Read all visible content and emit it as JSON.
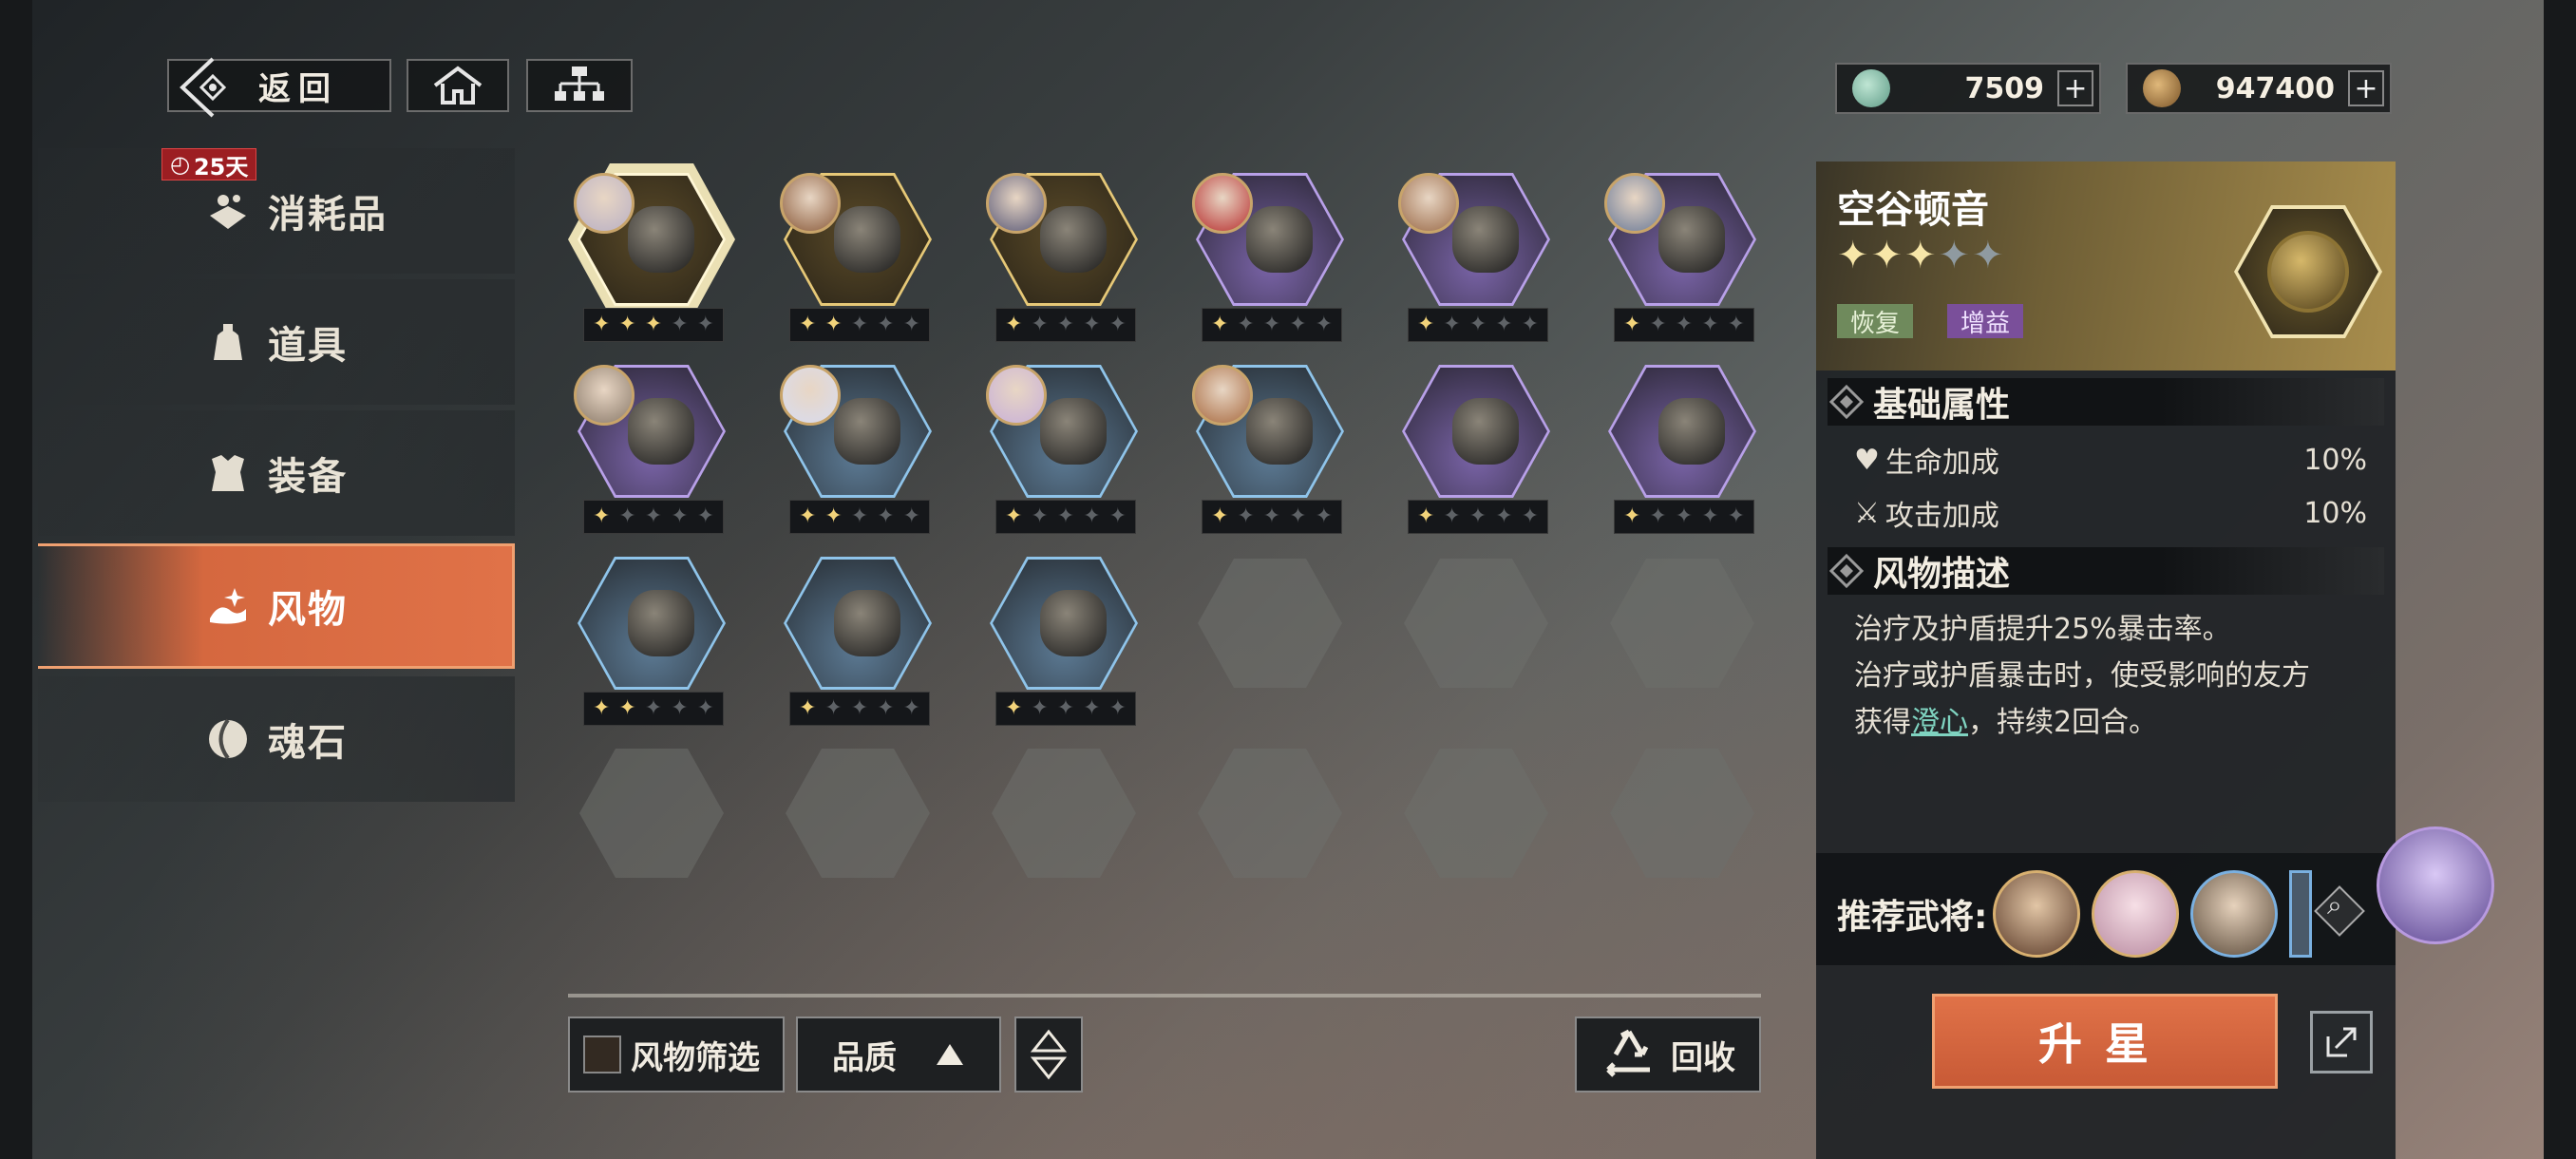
{
  "top_bar": {
    "back_label": "返回",
    "currency": [
      {
        "icon": "jade-token-icon",
        "value": "7509"
      },
      {
        "icon": "copper-coin-icon",
        "value": "947400"
      }
    ]
  },
  "sidebar": {
    "timer": "25天",
    "items": [
      {
        "label": "消耗品",
        "icon": "consumable-icon"
      },
      {
        "label": "道具",
        "icon": "item-bag-icon"
      },
      {
        "label": "装备",
        "icon": "armor-icon"
      },
      {
        "label": "风物",
        "icon": "curio-icon",
        "active": true
      },
      {
        "label": "魂石",
        "icon": "soul-stone-icon"
      }
    ]
  },
  "grid": {
    "items": [
      {
        "name": "coiled-dragon-medallion",
        "rarity": "gold",
        "stars": 3,
        "avatar": true,
        "selected": true
      },
      {
        "name": "bronze-bell",
        "rarity": "gold",
        "stars": 2,
        "avatar": true
      },
      {
        "name": "twin-bracelets",
        "rarity": "gold",
        "stars": 1,
        "avatar": true
      },
      {
        "name": "stone-seal",
        "rarity": "purple",
        "stars": 1,
        "avatar": true
      },
      {
        "name": "lion-mask",
        "rarity": "purple",
        "stars": 1,
        "avatar": true
      },
      {
        "name": "iron-balls",
        "rarity": "purple",
        "stars": 1,
        "avatar": true
      },
      {
        "name": "bronze-horseman",
        "rarity": "purple",
        "stars": 1,
        "avatar": true
      },
      {
        "name": "tripod-cauldron",
        "rarity": "blue",
        "stars": 2,
        "avatar": true
      },
      {
        "name": "black-pot",
        "rarity": "blue",
        "stars": 1,
        "avatar": true
      },
      {
        "name": "crossbow",
        "rarity": "blue",
        "stars": 1,
        "avatar": true
      },
      {
        "name": "silver-horse",
        "rarity": "purple",
        "stars": 1,
        "avatar": false
      },
      {
        "name": "incense-burner",
        "rarity": "purple",
        "stars": 1,
        "avatar": false
      },
      {
        "name": "curved-blade",
        "rarity": "blue",
        "stars": 2,
        "avatar": false
      },
      {
        "name": "halberd-head",
        "rarity": "blue",
        "stars": 1,
        "avatar": false
      },
      {
        "name": "spear-head",
        "rarity": "blue",
        "stars": 1,
        "avatar": false
      }
    ],
    "max_stars": 5
  },
  "bottom_bar": {
    "filter_label": "风物筛选",
    "quality_label": "品质",
    "recycle_label": "回收"
  },
  "detail": {
    "title": "空谷顿音",
    "stars": 3,
    "max_stars": 5,
    "tags": [
      "恢复",
      "增益"
    ],
    "basic_header": "基础属性",
    "attributes": [
      {
        "icon": "heart-plus-icon",
        "label": "生命加成",
        "value": "10%"
      },
      {
        "icon": "crossed-swords-icon",
        "label": "攻击加成",
        "value": "10%"
      }
    ],
    "desc_header": "风物描述",
    "desc_line1": "治疗及护盾提升25%暴击率。",
    "desc_line2": "治疗或护盾暴击时，使受影响的友方",
    "desc_line3_pre": "获得",
    "desc_keyword": "澄心",
    "desc_line3_post": "，持续2回合。",
    "recommend_label": "推荐武将:",
    "upgrade_label": "升星"
  },
  "colors": {
    "accent": "#e07248",
    "gold": "#f2d37a",
    "purple_rarity": "#9a7ad6",
    "blue_rarity": "#6aa6d0"
  }
}
